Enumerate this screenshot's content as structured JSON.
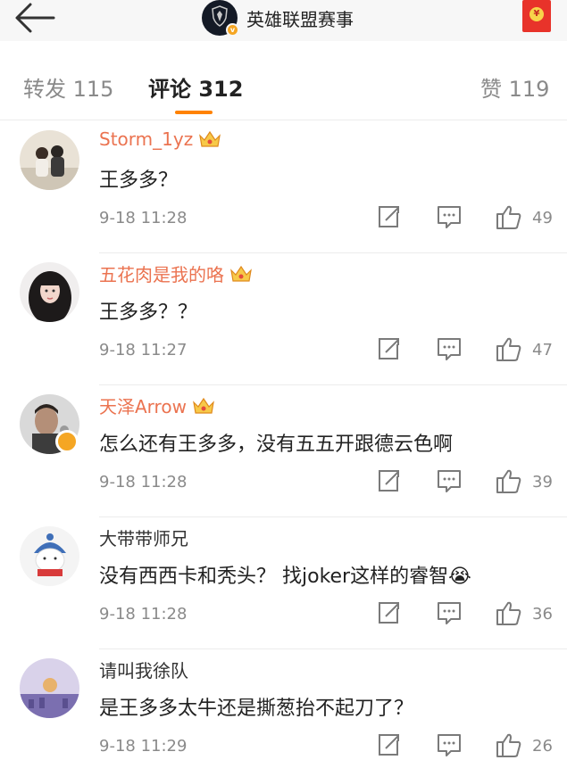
{
  "header": {
    "back_icon": "arrow-left-icon",
    "title": "英雄联盟赛事",
    "avatar_badge_icon": "verified-badge-icon",
    "redpacket_icon": "red-packet-icon",
    "redpacket_symbol": "¥"
  },
  "tabs": [
    {
      "label": "转发 115",
      "active": false
    },
    {
      "label": "评论 312",
      "active": true
    },
    {
      "label": "赞 119",
      "active": false
    }
  ],
  "colors": {
    "accent": "#ff8200",
    "username_vip": "#eb7350",
    "username_plain": "#333333",
    "meta_gray": "#8a8a8a"
  },
  "comments": [
    {
      "username": "Storm_1yz",
      "vip": true,
      "verified": false,
      "text": "王多多？",
      "time": "9-18 11:28",
      "likes": "49"
    },
    {
      "username": "五花肉是我的咯",
      "vip": true,
      "verified": false,
      "text": "王多多？？",
      "time": "9-18 11:27",
      "likes": "47"
    },
    {
      "username": "天泽Arrow",
      "vip": true,
      "verified": true,
      "text": "怎么还有王多多，没有五五开跟德云色啊",
      "time": "9-18 11:28",
      "likes": "39"
    },
    {
      "username": "大带带师兄",
      "vip": false,
      "verified": false,
      "text": "没有西西卡和秃头？ 找joker这样的睿智😭",
      "time": "9-18 11:28",
      "likes": "36"
    },
    {
      "username": "请叫我徐队",
      "vip": false,
      "verified": false,
      "text": "是王多多太牛还是撕葱抬不起刀了？",
      "time": "9-18 11:29",
      "likes": "26"
    }
  ]
}
